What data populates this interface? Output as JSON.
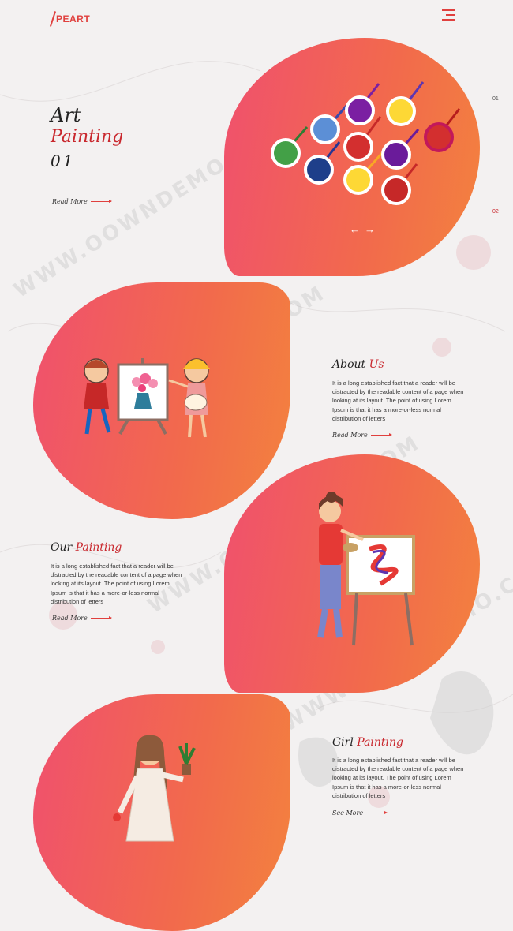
{
  "header": {
    "logo_text": "PEART",
    "menu_icon": "hamburger-menu-icon"
  },
  "hero": {
    "title_line1": "Art",
    "title_line2": "Painting",
    "title_line3": "01",
    "read_more": "Read More"
  },
  "slider": {
    "slide1": "01",
    "slide2": "02",
    "prev_icon": "arrow-left-icon",
    "next_icon": "arrow-right-icon"
  },
  "about": {
    "title_part1": "About",
    "title_part2": "Us",
    "text": "It is a long established fact that a reader will be distracted by the readable content of a page when looking at its layout. The point of using Lorem Ipsum is that it has a more-or-less normal distribution of letters",
    "read_more": "Read More"
  },
  "our_painting": {
    "title_part1": "Our",
    "title_part2": "Painting",
    "text": "It is a long established fact that a reader will be distracted by the readable content of a page when looking at its layout. The point of using Lorem Ipsum is that it has a more-or-less normal distribution of letters",
    "read_more": "Read More"
  },
  "girl_painting": {
    "title_part1": "Girl",
    "title_part2": "Painting",
    "text": "It is a long established fact that a reader will be distracted by the readable content of a page when looking at its layout. The point of using Lorem Ipsum is that it has a more-or-less normal distribution of letters",
    "see_more": "See More"
  },
  "watermark": "WWW.OOWNDEMO.COM",
  "colors": {
    "accent": "#e0403e",
    "dark_red": "#c9282e",
    "blob_start": "#f0506e",
    "blob_end": "#f3823e"
  }
}
